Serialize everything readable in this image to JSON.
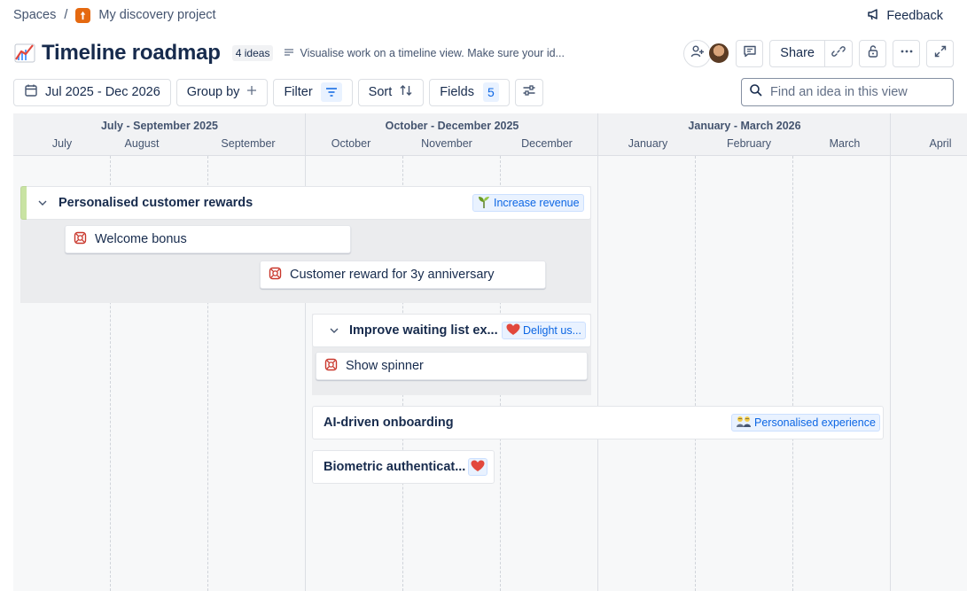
{
  "breadcrumb": {
    "spaces": "Spaces",
    "separator": "/",
    "project": "My discovery project"
  },
  "feedback_label": "Feedback",
  "header": {
    "title": "Timeline roadmap",
    "idea_count": "4 ideas",
    "description": "Visualise work on a timeline view. Make sure your id...",
    "share_label": "Share"
  },
  "toolbar": {
    "date_range": "Jul 2025 - Dec 2026",
    "group_by": "Group by",
    "filter": "Filter",
    "sort": "Sort",
    "fields": "Fields",
    "fields_count": "5"
  },
  "search": {
    "placeholder": "Find an idea in this view"
  },
  "timeline": {
    "quarters": [
      "July - September 2025",
      "October - December 2025",
      "January - March 2026"
    ],
    "months": [
      "July",
      "August",
      "September",
      "October",
      "November",
      "December",
      "January",
      "February",
      "March",
      "April"
    ]
  },
  "groups": [
    {
      "title": "Personalised customer rewards",
      "goal": "Increase revenue",
      "goal_icon": "seedling-icon",
      "ideas": [
        "Welcome bonus",
        "Customer reward for 3y anniversary"
      ]
    },
    {
      "title": "Improve waiting list ex...",
      "goal": "Delight us...",
      "goal_icon": "heart-icon",
      "ideas": [
        "Show spinner"
      ]
    }
  ],
  "standalone": [
    {
      "title": "AI-driven onboarding",
      "goal": "Personalised experience",
      "goal_icon": "people-icon"
    },
    {
      "title": "Biometric authenticat...",
      "goal_icon": "heart-icon"
    }
  ],
  "colors": {
    "accent": "#0c66e4",
    "idea_icon": "#c9372c",
    "group_accent": "#94c748"
  }
}
